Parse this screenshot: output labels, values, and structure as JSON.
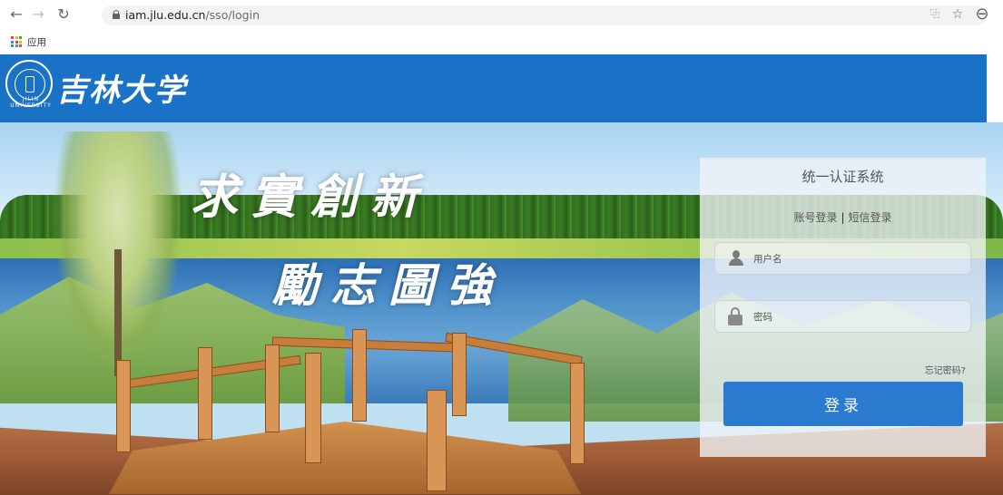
{
  "browser": {
    "url_host": "iam.jlu.edu.cn",
    "url_path": "/sso/login",
    "bookmark_apps_label": "应用"
  },
  "header": {
    "seal_text": "JILIN UNIVERSITY",
    "site_title": "吉林大学"
  },
  "hero": {
    "slogan_line1": "求實創新",
    "slogan_line2": "勵志圖強"
  },
  "login": {
    "title": "统一认证系统",
    "tab_account": "账号登录",
    "tab_separator": "|",
    "tab_sms": "短信登录",
    "username_placeholder": "用户名",
    "password_placeholder": "密码",
    "forgot_password": "忘记密码?",
    "submit_label": "登录"
  },
  "colors": {
    "header_blue": "#1a72c7",
    "button_blue": "#2a7ad0"
  }
}
